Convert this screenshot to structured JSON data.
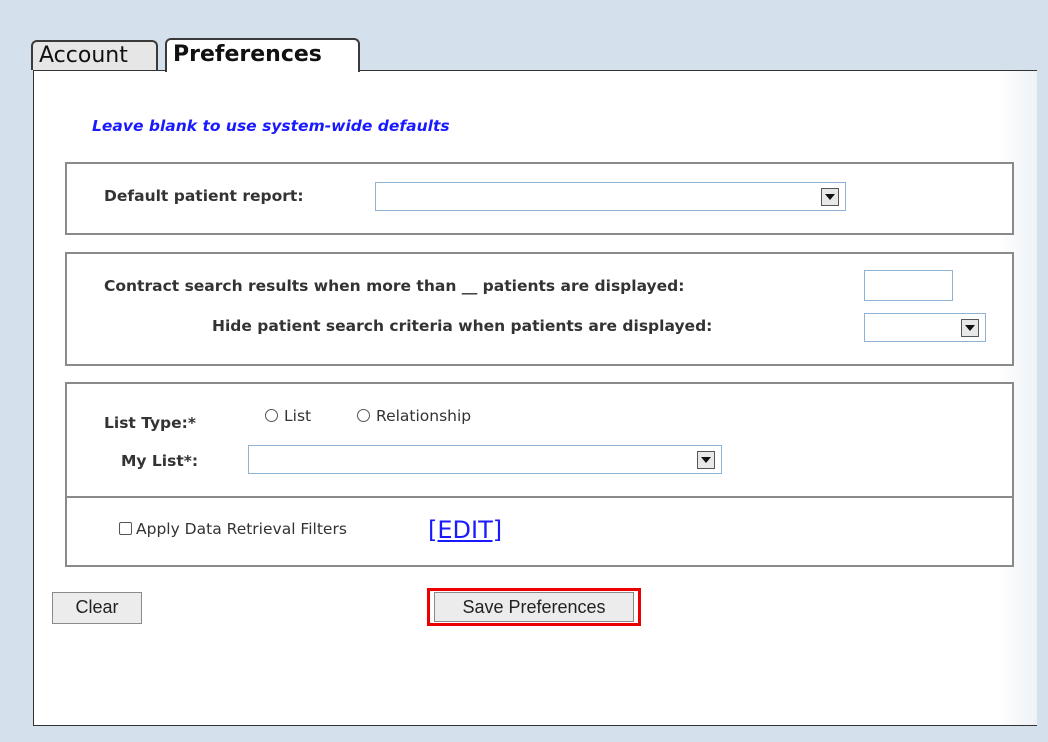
{
  "tabs": [
    {
      "label": "Account",
      "active": false
    },
    {
      "label": "Preferences",
      "active": true
    }
  ],
  "hint": "Leave blank to use system-wide defaults",
  "default_report": {
    "label": "Default patient report:",
    "value": ""
  },
  "search": {
    "contract_label": "Contract search results when more than __ patients are displayed:",
    "contract_value": "",
    "hide_label": "Hide patient search criteria when patients are displayed:",
    "hide_value": ""
  },
  "list": {
    "type_label": "List Type:*",
    "options": [
      "List",
      "Relationship"
    ],
    "my_list_label": "My List*:",
    "my_list_value": ""
  },
  "filters": {
    "label": "Apply Data Retrieval Filters",
    "checked": false,
    "edit_label": "[EDIT]"
  },
  "buttons": {
    "clear": "Clear",
    "save": "Save Preferences"
  },
  "colors": {
    "hint": "#1a1aff",
    "highlight": "#ee0000",
    "background": "#d4e0ec"
  }
}
